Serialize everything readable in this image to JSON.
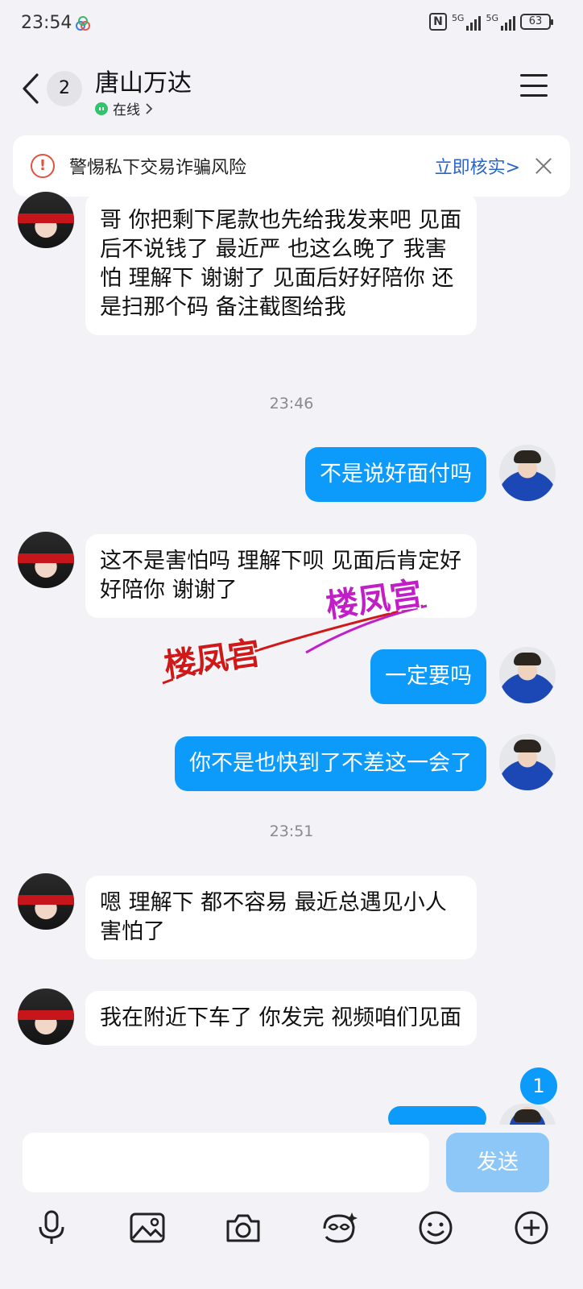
{
  "status_bar": {
    "time": "23:54",
    "network_1": "5G",
    "network_2": "5G",
    "battery": "63"
  },
  "header": {
    "unread_count": "2",
    "title": "唐山万达",
    "status": "在线"
  },
  "warning": {
    "text": "警惕私下交易诈骗风险",
    "action": "立即核实>"
  },
  "messages": [
    {
      "side": "in",
      "text": "哥 你把剩下尾款也先给我发来吧 见面后不说钱了 最近严 也这么晚了 我害怕 理解下 谢谢了 见面后好好陪你 还是扫那个码 备注截图给我"
    },
    {
      "type": "time",
      "text": "23:46"
    },
    {
      "side": "out",
      "text": "不是说好面付吗"
    },
    {
      "side": "in",
      "text": "这不是害怕吗 理解下呗 见面后肯定好好陪你 谢谢了"
    },
    {
      "side": "out",
      "text": "一定要吗"
    },
    {
      "side": "out",
      "text": "你不是也快到了不差这一会了"
    },
    {
      "type": "time",
      "text": "23:51"
    },
    {
      "side": "in",
      "text": "嗯 理解下 都不容易 最近总遇见小人 害怕了"
    },
    {
      "side": "in",
      "text": "我在附近下车了 你发完 视频咱们见面"
    }
  ],
  "watermarks": [
    "楼凤宫",
    "楼凤宫"
  ],
  "new_message_badge": "1",
  "input": {
    "placeholder": "",
    "send_label": "发送"
  },
  "toolbar_icons": [
    "microphone-icon",
    "image-icon",
    "camera-icon",
    "emoji-pack-icon",
    "smiley-icon",
    "plus-icon"
  ],
  "colors": {
    "accent": "#0c9bfb",
    "send_disabled": "#8cc7f7",
    "warning": "#e0533e",
    "link": "#2a66c9",
    "watermark_red": "#d01818",
    "watermark_magenta": "#c21ec8"
  }
}
